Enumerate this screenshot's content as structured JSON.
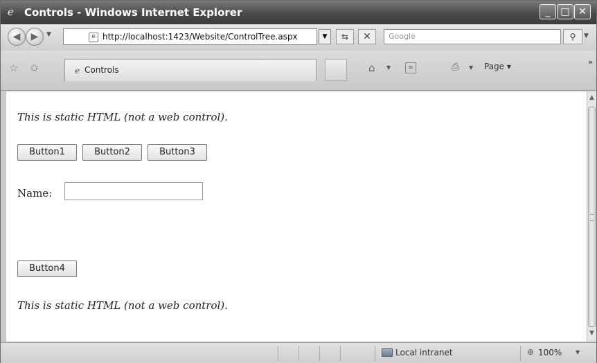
{
  "window": {
    "title": "Controls - Windows Internet Explorer",
    "controls": {
      "minimize": "_",
      "maximize": "□",
      "close": "✕"
    }
  },
  "nav": {
    "address": "http://localhost:1423/Website/ControlTree.aspx",
    "search_placeholder": "Google"
  },
  "tabs": [
    {
      "label": "Controls"
    }
  ],
  "toolbar": {
    "page_label": "Page"
  },
  "content": {
    "static_text_top": "This is static HTML (not a web control).",
    "buttons": [
      "Button1",
      "Button2",
      "Button3"
    ],
    "name_label": "Name:",
    "name_value": "",
    "button4": "Button4",
    "static_text_bottom": "This is static HTML (not a web control)."
  },
  "status": {
    "zone": "Local intranet",
    "zoom": "100%"
  },
  "icons": {
    "title": "ie-logo-icon",
    "back": "back-arrow-icon",
    "forward": "forward-arrow-icon",
    "refresh": "refresh-icon",
    "stop": "stop-icon",
    "search": "search-icon",
    "favorites": "favorites-star-icon",
    "home": "home-icon",
    "feeds": "feed-icon",
    "print": "print-icon",
    "zone": "intranet-zone-icon",
    "zoom": "zoom-icon"
  }
}
